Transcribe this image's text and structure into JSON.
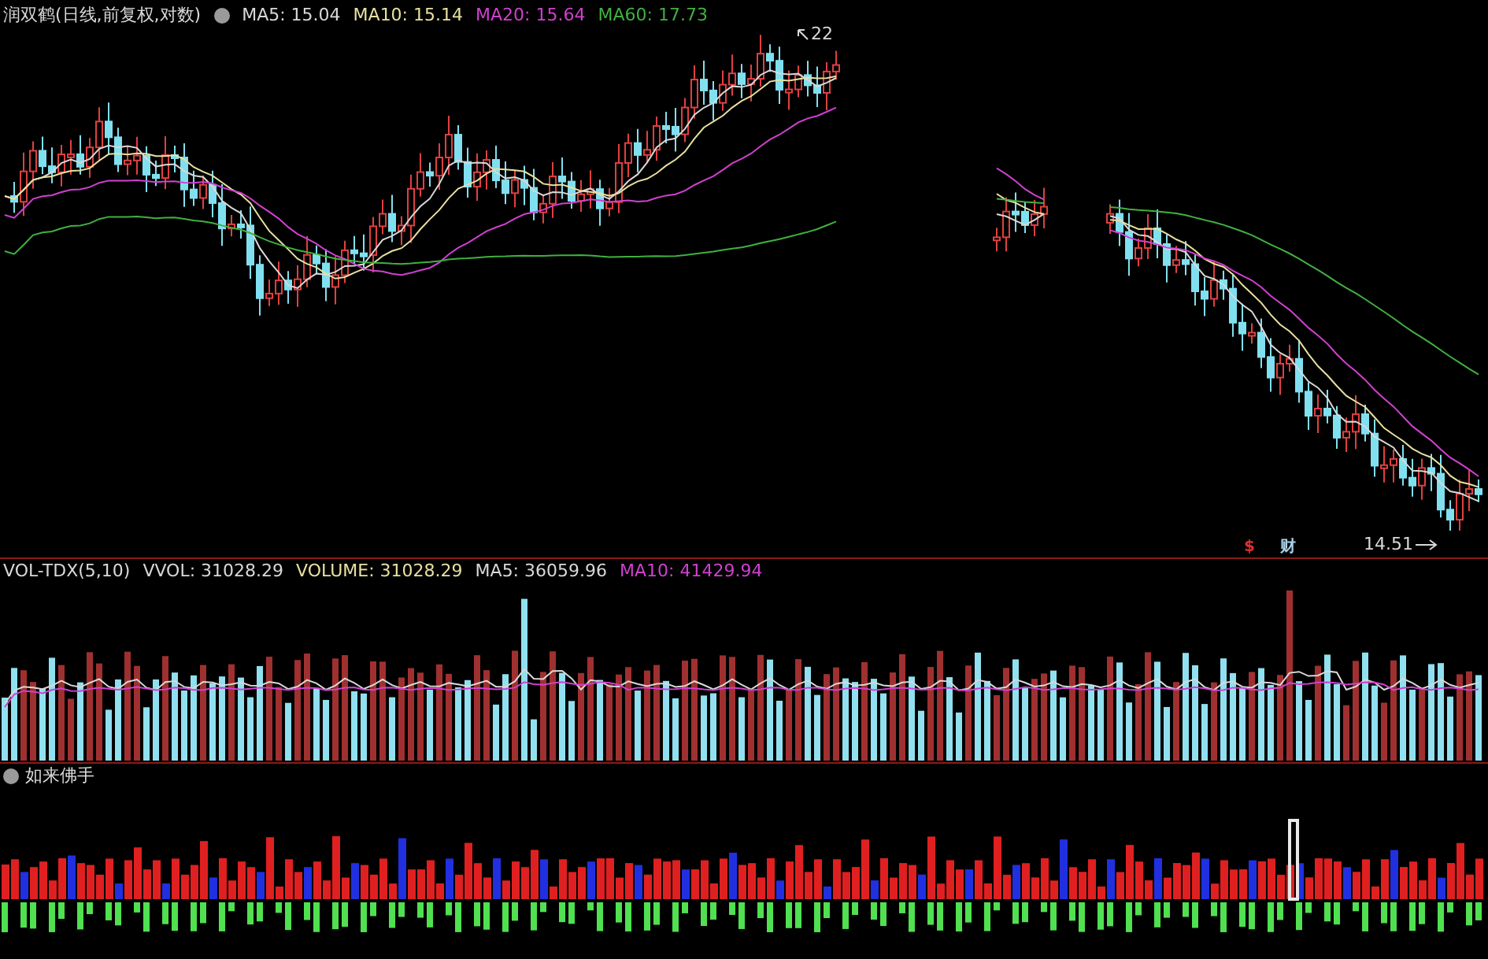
{
  "main_chart": {
    "title": "润双鹤(日线,前复权,对数)",
    "ma_values": [
      {
        "label": "MA5: 15.04",
        "color": "#d8d8d8"
      },
      {
        "label": "MA10: 15.14",
        "color": "#e8e0a0"
      },
      {
        "label": "MA20: 15.64",
        "color": "#d040d0"
      },
      {
        "label": "MA60: 17.73",
        "color": "#40b040"
      }
    ],
    "high_marker": "22",
    "low_marker": "14.51",
    "event_marks": [
      {
        "text": "$",
        "color": "#e03030"
      },
      {
        "text": "财",
        "color": "#a8d0e8"
      }
    ]
  },
  "volume_panel": {
    "title": "VOL-TDX(5,10)",
    "readings": [
      {
        "label": "VVOL: 31028.29",
        "color": "#d8d8d8"
      },
      {
        "label": "VOLUME: 31028.29",
        "color": "#e8e0a0"
      },
      {
        "label": "MA5: 36059.96",
        "color": "#d8d8d8"
      },
      {
        "label": "MA10: 41429.94",
        "color": "#d040d0"
      }
    ]
  },
  "indicator_panel": {
    "title": "如来佛手"
  }
}
